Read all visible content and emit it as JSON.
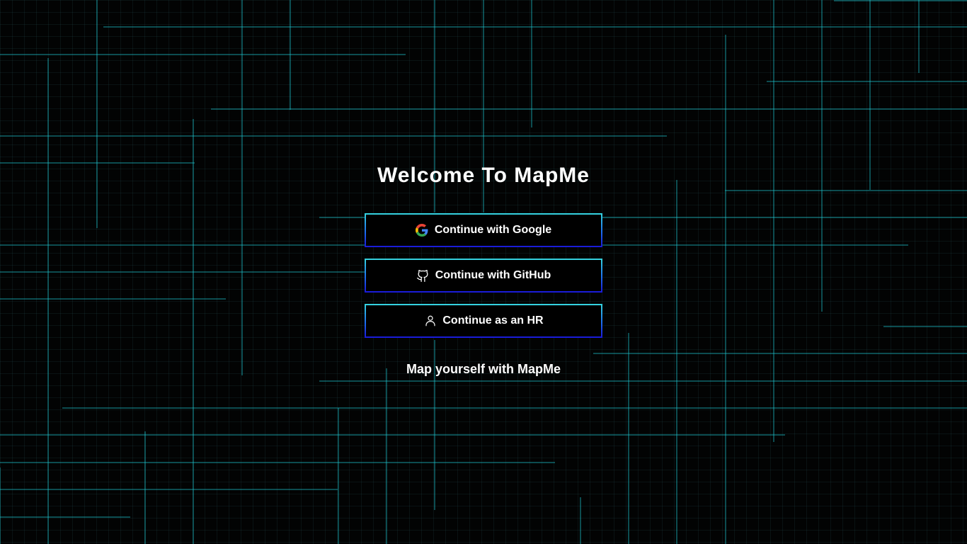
{
  "page": {
    "title": "Welcome To MapMe",
    "tagline": "Map yourself with MapMe"
  },
  "auth": {
    "google_label": "Continue with Google",
    "github_label": "Continue with GitHub",
    "hr_label": "Continue as an HR"
  },
  "icons": {
    "google": "google-logo-icon",
    "github": "github-icon",
    "hr": "user-icon"
  },
  "colors": {
    "background": "#020303",
    "grid_line": "#1fc6cf",
    "button_border_top": "#35d3df",
    "button_border_bottom": "#1a1ad8",
    "text": "#ffffff"
  }
}
